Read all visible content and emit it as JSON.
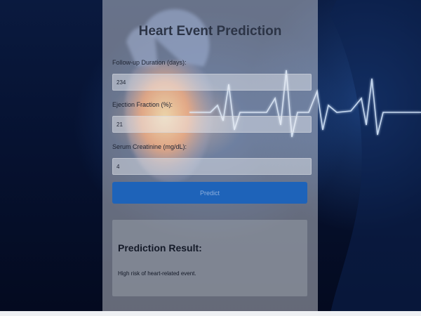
{
  "page": {
    "title": "Heart Event Prediction"
  },
  "form": {
    "fields": [
      {
        "label": "Follow-up Duration (days):",
        "value": "234"
      },
      {
        "label": "Ejection Fraction (%):",
        "value": "21"
      },
      {
        "label": "Serum Creatinine (mg/dL):",
        "value": "4"
      }
    ],
    "submit_label": "Predict"
  },
  "result": {
    "heading": "Prediction Result:",
    "message": "High risk of heart-related event."
  },
  "colors": {
    "button": "#1e63b9",
    "background": "#061231",
    "heartbeat_line": "#d8eaff"
  },
  "background_image": "heart-with-ecg-line"
}
